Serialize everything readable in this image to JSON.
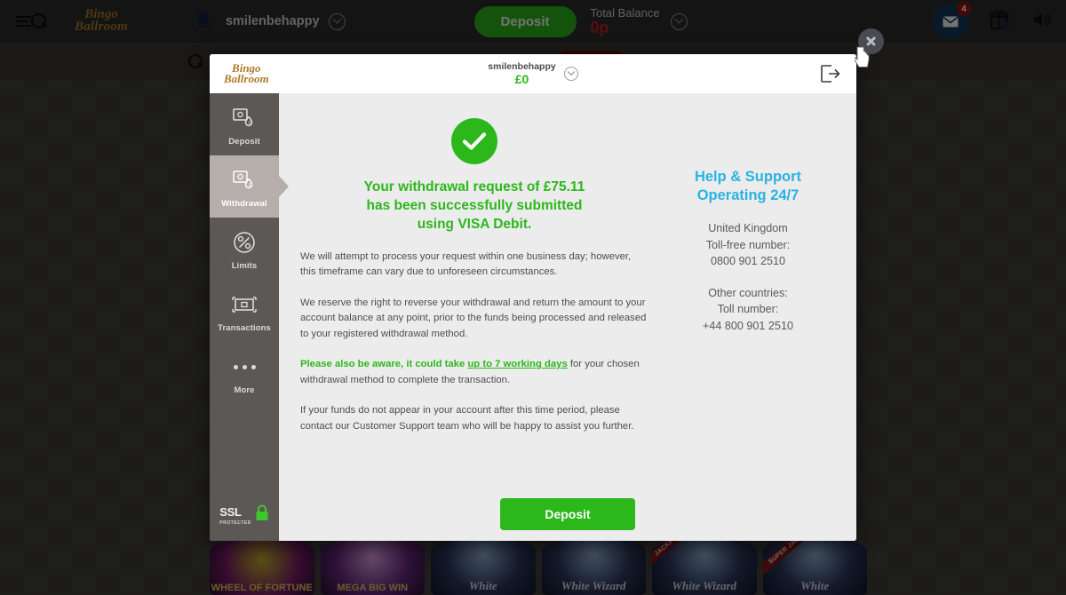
{
  "header": {
    "menu_icon": "hamburger-search-icon",
    "brand_line1": "Bingo",
    "brand_line2": "Ballroom",
    "username": "smilenbehappy",
    "deposit_label": "Deposit",
    "balance_label": "Total Balance",
    "balance_value": "0p",
    "mail_badge": "4",
    "icons": [
      "mail-icon",
      "gift-icon",
      "sound-icon"
    ],
    "accent_green": "#2cb81b",
    "balance_red": "#c62020"
  },
  "background": {
    "search_icon": "search-icon",
    "games": [
      {
        "label": "WHEEL OF FORTUNE",
        "jackpot": ""
      },
      {
        "label": "MEGA BIG WIN",
        "jackpot": ""
      },
      {
        "label": "White",
        "jackpot": ""
      },
      {
        "label": "White Wizard",
        "jackpot": ""
      },
      {
        "label": "White Wizard",
        "jackpot": "JACKPOT"
      },
      {
        "label": "White",
        "jackpot": "SUPER JACKPOT"
      }
    ]
  },
  "modal": {
    "brand_line1": "Bingo",
    "brand_line2": "Ballroom",
    "username": "smilenbehappy",
    "balance": "£0",
    "logout_icon": "logout-icon",
    "sidebar": [
      {
        "label": "Deposit",
        "icon": "deposit-icon",
        "active": false
      },
      {
        "label": "Withdrawal",
        "icon": "withdrawal-icon",
        "active": true
      },
      {
        "label": "Limits",
        "icon": "limits-icon",
        "active": false
      },
      {
        "label": "Transactions",
        "icon": "transactions-icon",
        "active": false
      },
      {
        "label": "More",
        "icon": "more-dots-icon",
        "active": false
      }
    ],
    "ssl_badge": {
      "title": "SSL",
      "subtitle": "PROTECTED",
      "icon": "padlock-icon"
    },
    "success": {
      "icon": "checkmark-circle-icon",
      "line1": "Your withdrawal request of £75.11",
      "line2": "has been successfully submitted",
      "line3": "using VISA Debit.",
      "color": "#2cb81b"
    },
    "paragraphs": {
      "p1": "We will attempt to process your request within one business day; however, this timeframe can vary due to unforeseen circumstances.",
      "p2": "We reserve the right to reverse your withdrawal and return the amount to your account balance at any point, prior to the funds being processed and released to your registered withdrawal method.",
      "p3_lead": "Please also be aware, it could take ",
      "p3_link": "up to 7 working days",
      "p3_rest": " for your chosen withdrawal method to complete the transaction.",
      "p4": "If your funds do not appear in your account after this time period, please contact our Customer Support team who will be happy to assist you further."
    },
    "help": {
      "title_line1": "Help & Support",
      "title_line2": "Operating 24/7",
      "title_color": "#29b3e3",
      "region1_name": "United Kingdom",
      "region1_label": "Toll-free number:",
      "region1_number": "0800 901 2510",
      "region2_name": "Other countries:",
      "region2_label": "Toll number:",
      "region2_number": "+44 800 901 2510"
    },
    "footer_deposit_label": "Deposit",
    "close_icon": "close-icon"
  }
}
